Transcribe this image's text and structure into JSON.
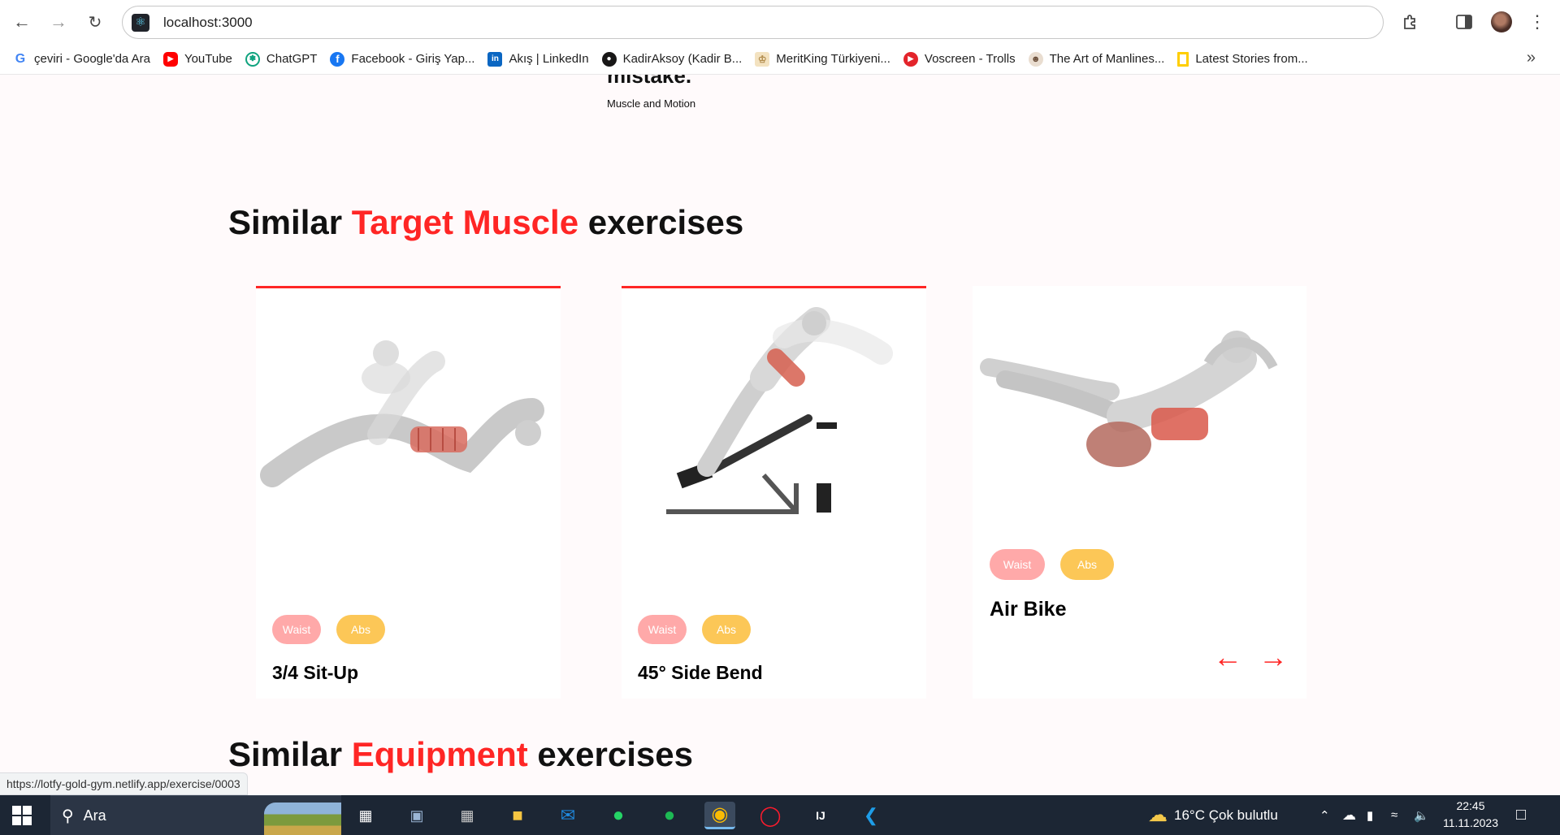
{
  "browser": {
    "url": "localhost:3000",
    "bookmarks": [
      {
        "label": "çeviri - Google'da Ara",
        "icon": "google-icon",
        "color": "#4285f4"
      },
      {
        "label": "YouTube",
        "icon": "youtube-icon",
        "color": "#ff0000"
      },
      {
        "label": "ChatGPT",
        "icon": "chatgpt-icon",
        "color": "#10a37f"
      },
      {
        "label": "Facebook - Giriş Yap...",
        "icon": "facebook-icon",
        "color": "#1877f2"
      },
      {
        "label": "Akış | LinkedIn",
        "icon": "linkedin-icon",
        "color": "#0a66c2"
      },
      {
        "label": "KadirAksoy (Kadir B...",
        "icon": "github-icon",
        "color": "#181717"
      },
      {
        "label": "MeritKing Türkiyeni...",
        "icon": "meritking-icon",
        "color": "#d9b46c"
      },
      {
        "label": "Voscreen - Trolls",
        "icon": "voscreen-icon",
        "color": "#e3242b"
      },
      {
        "label": "The Art of Manlines...",
        "icon": "artofmanliness-icon",
        "color": "#6b4f3a"
      },
      {
        "label": "Latest Stories from...",
        "icon": "natgeo-icon",
        "color": "#ffce00"
      }
    ],
    "status_url": "https://lotfy-gold-gym.netlify.app/exercise/0003"
  },
  "page": {
    "partial_heading": "mistake.",
    "partial_source": "Muscle and Motion",
    "similar_target": {
      "prefix": "Similar",
      "accent": "Target Muscle",
      "suffix": "exercises"
    },
    "exercises": [
      {
        "name": "3/4 Sit-Up",
        "body_part": "Waist",
        "target": "Abs"
      },
      {
        "name": "45° Side Bend",
        "body_part": "Waist",
        "target": "Abs"
      },
      {
        "name": "Air Bike",
        "body_part": "Waist",
        "target": "Abs"
      }
    ],
    "prev_arrow": "←",
    "next_arrow": "→",
    "similar_equipment": {
      "prefix": "Similar",
      "accent": "Equipment",
      "suffix": "exercises"
    }
  },
  "taskbar": {
    "search_placeholder": "Ara",
    "weather_temp": "16°C",
    "weather_text": "Çok bulutlu",
    "time": "22:45",
    "date": "11.11.2023"
  },
  "colors": {
    "accent": "#ff2625",
    "waist_chip": "#ffa9a9",
    "abs_chip": "#fcc757",
    "page_bg": "#fffafb"
  }
}
